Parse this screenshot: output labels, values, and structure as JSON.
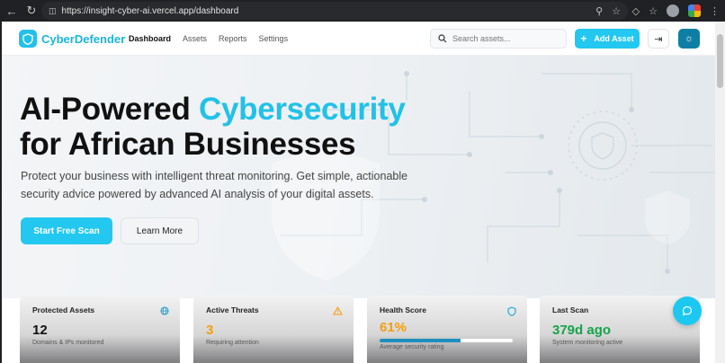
{
  "browser": {
    "url": "https://insight-cyber-ai.vercel.app/dashboard"
  },
  "header": {
    "brand": "CyberDefender",
    "nav": [
      "Dashboard",
      "Assets",
      "Reports",
      "Settings"
    ],
    "search_placeholder": "Search assets...",
    "add_label": "Add Asset"
  },
  "hero": {
    "title_part1": "AI-Powered ",
    "title_accent": "Cybersecurity",
    "title_line2": "for African Businesses",
    "subtitle": "Protect your business with intelligent threat monitoring. Get simple, actionable security advice powered by advanced AI analysis of your digital assets.",
    "primary_cta": "Start Free Scan",
    "secondary_cta": "Learn More"
  },
  "stats": [
    {
      "title": "Protected Assets",
      "value": "12",
      "desc": "Domains & IPs monitored",
      "icon": "globe-icon",
      "color": "#111111"
    },
    {
      "title": "Active Threats",
      "value": "3",
      "desc": "Requiring attention",
      "icon": "warning-icon",
      "color": "#f59e0b"
    },
    {
      "title": "Health Score",
      "value": "61%",
      "desc": "Average security rating",
      "icon": "shield-icon",
      "color": "#f59e0b",
      "progress": 0.61
    },
    {
      "title": "Last Scan",
      "value": "379d ago",
      "desc": "System monitoring active",
      "icon": "check-icon",
      "color": "#16a34a"
    }
  ],
  "colors": {
    "accent": "#22c1e8",
    "warning": "#f59e0b",
    "success": "#16a34a"
  }
}
